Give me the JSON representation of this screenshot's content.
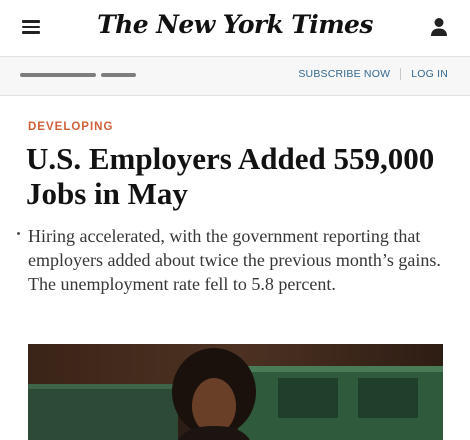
{
  "header": {
    "logo_text": "The New York Times",
    "menu_icon": "hamburger-menu-icon",
    "account_icon": "user-account-icon"
  },
  "subbar": {
    "subscribe_label": "SUBSCRIBE NOW",
    "login_label": "LOG IN"
  },
  "article": {
    "kicker": "DEVELOPING",
    "headline": "U.S. Employers Added 559,000 Jobs in May",
    "summary": "Hiring accelerated, with the government reporting that employers added about twice the previous month’s gains. The unemployment rate fell to 5.8 percent."
  },
  "colors": {
    "kicker": "#d0613a",
    "link": "#326891",
    "text": "#121212"
  }
}
